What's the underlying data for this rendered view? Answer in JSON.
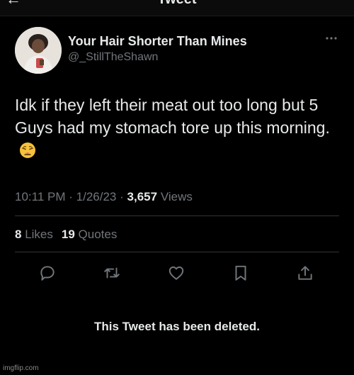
{
  "header": {
    "title": "Tweet",
    "back_icon": "arrow-left-icon"
  },
  "author": {
    "display_name": "Your Hair Shorter Than Mines",
    "handle": "@_StillTheShawn"
  },
  "tweet": {
    "text": "Idk if they left their meat out too long but 5 Guys had my stomach tore up this morning.",
    "emoji": "weary-face"
  },
  "meta": {
    "time": "10:11 PM",
    "date": "1/26/23",
    "views_count": "3,657",
    "views_label": "Views",
    "separator": "·"
  },
  "stats": {
    "likes_count": "8",
    "likes_label": "Likes",
    "quotes_count": "19",
    "quotes_label": "Quotes"
  },
  "actions": [
    "reply-icon",
    "retweet-icon",
    "like-icon",
    "bookmark-icon",
    "share-icon"
  ],
  "deleted_notice": "This Tweet has been deleted.",
  "watermark": "imgflip.com",
  "colors": {
    "background": "#000000",
    "text": "#e7e9ea",
    "secondary": "#71767b",
    "divider": "#2f3336"
  }
}
